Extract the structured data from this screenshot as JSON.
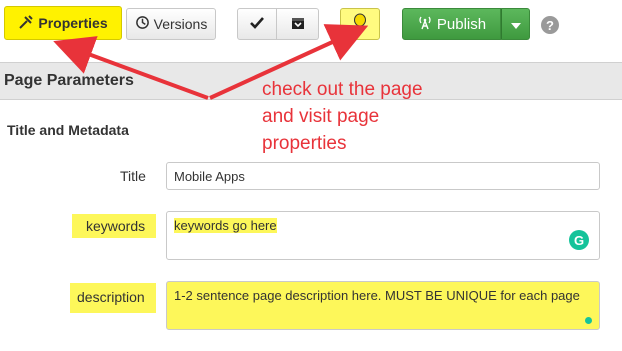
{
  "toolbar": {
    "properties_label": "Properties",
    "versions_label": "Versions",
    "publish_label": "Publish",
    "help_label": "?"
  },
  "section": {
    "title": "Page Parameters",
    "subtitle": "Title and Metadata"
  },
  "fields": {
    "title": {
      "label": "Title",
      "value": "Mobile Apps"
    },
    "keywords": {
      "label": "keywords",
      "value": "keywords go here"
    },
    "description": {
      "label": "description",
      "value": "1-2 sentence page description here.  MUST BE UNIQUE for each page"
    }
  },
  "annotation": {
    "line1": "check out the page",
    "line2": "and visit page",
    "line3": "properties"
  },
  "colors": {
    "highlight": "#fdf75a",
    "annotation": "#e8333a",
    "publish": "#4cae4c"
  },
  "icons": [
    "tools-icon",
    "history-icon",
    "checkmark-icon",
    "archive-icon",
    "lightbulb-icon",
    "broadcast-icon",
    "caret-down-icon",
    "help-icon",
    "grammarly-icon"
  ]
}
